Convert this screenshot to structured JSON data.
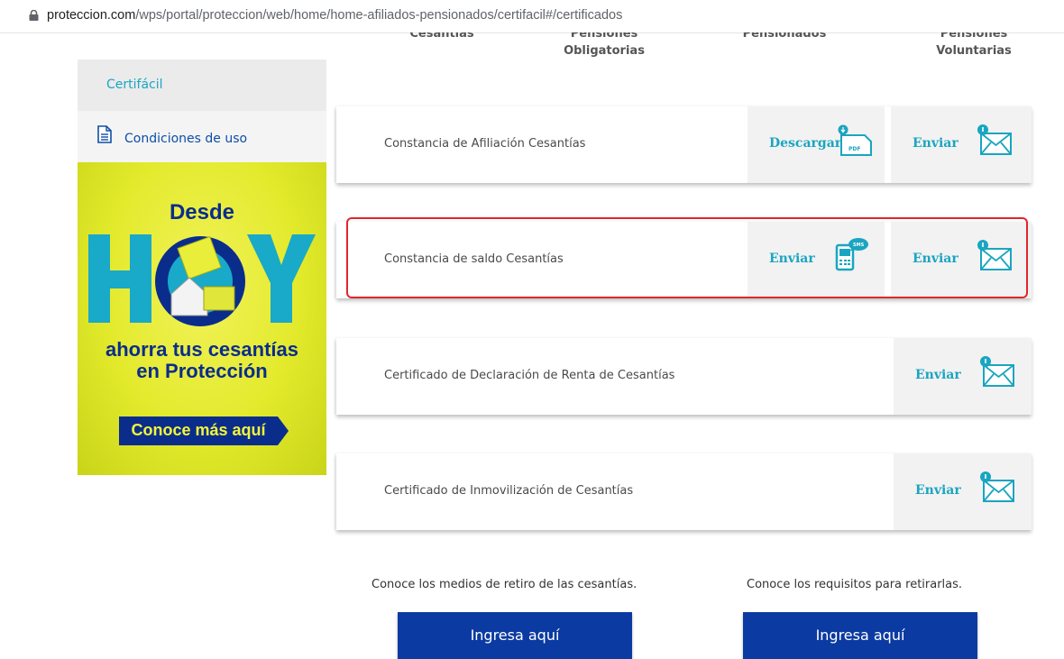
{
  "browser": {
    "url_domain": "proteccion.com",
    "url_path": "/wps/portal/proteccion/web/home/home-afiliados-pensionados/certifacil#/certificados"
  },
  "columns": {
    "cesantias": "Cesantías",
    "pensiones_obligatorias_line1": "Pensiones",
    "pensiones_obligatorias_line2": "Obligatorias",
    "pensionados": "Pensionados",
    "pensiones_voluntarias_line1": "Pensiones",
    "pensiones_voluntarias_line2": "Voluntarias"
  },
  "sidebar": {
    "items": [
      {
        "label": "Certifácil",
        "active": true
      },
      {
        "label": "Condiciones de uso",
        "icon": "document-icon"
      }
    ]
  },
  "banner": {
    "line_top": "Desde",
    "line_big": "HOY",
    "line_1": "ahorra tus cesantías",
    "line_2": "en Protección",
    "cta": "Conoce más aquí"
  },
  "certificates": [
    {
      "title": "Constancia de Afiliación Cesantías",
      "actions": [
        {
          "label": "Descargar",
          "icon": "pdf-download-icon"
        },
        {
          "label": "Enviar",
          "icon": "email-icon"
        }
      ]
    },
    {
      "title": "Constancia de saldo Cesantías",
      "highlighted": true,
      "actions": [
        {
          "label": "Enviar",
          "icon": "sms-phone-icon"
        },
        {
          "label": "Enviar",
          "icon": "email-icon"
        }
      ]
    },
    {
      "title": "Certificado de Declaración de Renta de Cesantías",
      "actions": [
        {
          "label": "Enviar",
          "icon": "email-icon"
        }
      ]
    },
    {
      "title": "Certificado de Inmovilización de Cesantías",
      "actions": [
        {
          "label": "Enviar",
          "icon": "email-icon"
        }
      ]
    }
  ],
  "footer": {
    "left_text": "Conoce los medios de retiro de las cesantías.",
    "right_text": "Conoce los requisitos para retirarlas.",
    "left_button": "Ingresa aquí",
    "right_button": "Ingresa aquí"
  },
  "colors": {
    "accent_teal": "#1aa5c0",
    "primary_blue": "#0b3aa2",
    "banner_yellow": "#e3ea2c",
    "highlight_red": "#e2262c"
  }
}
